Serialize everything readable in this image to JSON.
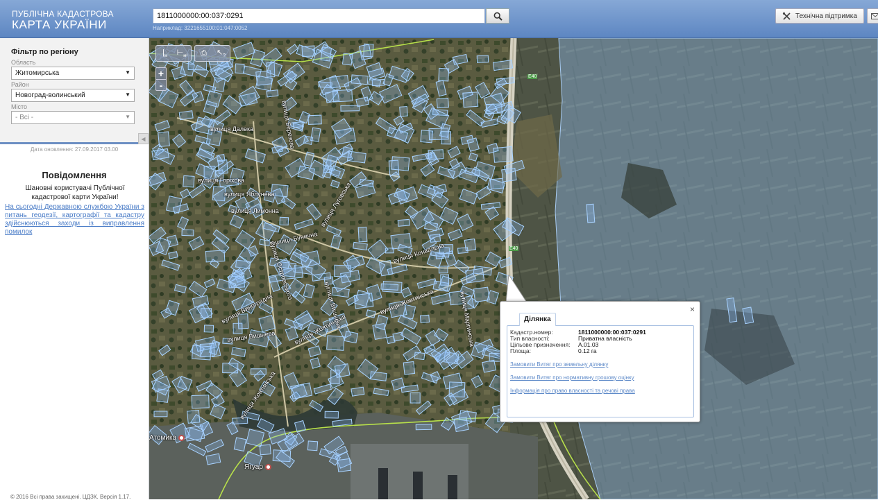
{
  "header": {
    "title_line1": "ПУБЛІЧНА КАДАСТРОВА",
    "title_line2": "КАРТА УКРАЇНИ",
    "search_value": "1811000000:00:037:0291",
    "search_hint": "Наприклад: 3221655100:01:047:0052",
    "support_label": "Технічна підтримка",
    "icons": {
      "search": "search-icon",
      "support": "tools-icon",
      "mail": "mail-icon"
    }
  },
  "filter": {
    "title": "Фільтр по регіону",
    "oblast_label": "Область",
    "oblast_value": "Житомирська",
    "raion_label": "Район",
    "raion_value": "Новоград-волинський",
    "misto_label": "Місто",
    "misto_value": "- Всі -"
  },
  "updated": "Дата оновлення: 27.09.2017 03.00",
  "notice": {
    "title": "Повідомлення",
    "text": "Шановні користувачі Публічної кадастрової карти України!",
    "link": "На сьогодні Державною службою України з питань геодезії, картографії та кадастру здійснюються заходи із виправлення помилок"
  },
  "copyright": "© 2016 Всі права захищені. ЦДЗК. Версія 1.17.",
  "map": {
    "toolbar": [
      "measure-length-icon",
      "measure-area-icon",
      "print-icon",
      "identify-icon"
    ],
    "zoom_in": "+",
    "zoom_out": "-",
    "road_label": "E40",
    "streets": [
      "вулиця Далека",
      "вулиця Горіхова",
      "вулиця Яблунева",
      "вулиця Лимонна",
      "вулиця Вишнева",
      "вулиця Бунична",
      "вулиця Конвальна",
      "вулиця Жовтинська",
      "вулиця Виноградна",
      "вулиця Вишнева",
      "вулиця Жовтинська",
      "вулиця Островського",
      "вулиця Березова",
      "вулиця Маргинська",
      "вулиця Жовтинська",
      "вулиця Луговська"
    ],
    "places": [
      "Атомика",
      "Ягуар"
    ]
  },
  "popup": {
    "tab": "Ділянка",
    "close": "×",
    "rows": [
      {
        "k": "Кадастр.номер:",
        "v": "1811000000:00:037:0291"
      },
      {
        "k": "Тип власності:",
        "v": "Приватна власність"
      },
      {
        "k": "Цільове призначення:",
        "v": "А.01.03"
      },
      {
        "k": "Площа:",
        "v": "0.12 га"
      }
    ],
    "links": [
      "Замовити Витяг про земельну ділянку",
      "Замовити Витяг про нормативну грошову оцінку",
      "Інформація про право власності та речові права"
    ]
  },
  "colors": {
    "header": "#5d86c2",
    "parcel": "#8fc2ff",
    "accent": "#6d8fc3"
  }
}
